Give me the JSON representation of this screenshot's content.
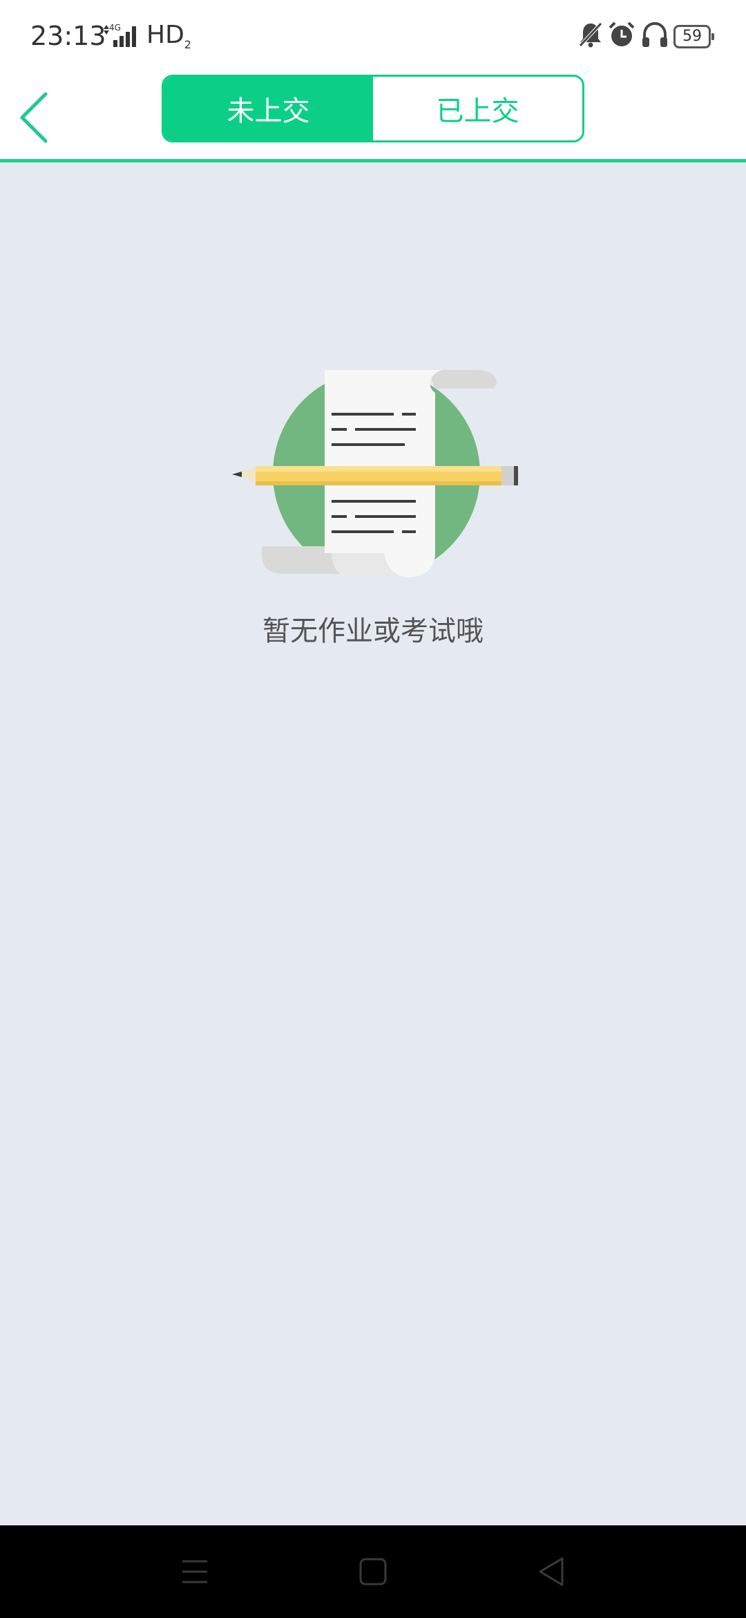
{
  "status_bar": {
    "time": "23:13",
    "network": "4G",
    "hd": "HD",
    "hd_sub": "2",
    "battery": "59"
  },
  "header": {
    "tabs": [
      {
        "label": "未上交",
        "active": true
      },
      {
        "label": "已上交",
        "active": false
      }
    ]
  },
  "empty_state": {
    "message": "暂无作业或考试哦"
  },
  "colors": {
    "accent": "#0ccf87",
    "divider": "#21d18f",
    "background": "#e5eaf0"
  }
}
